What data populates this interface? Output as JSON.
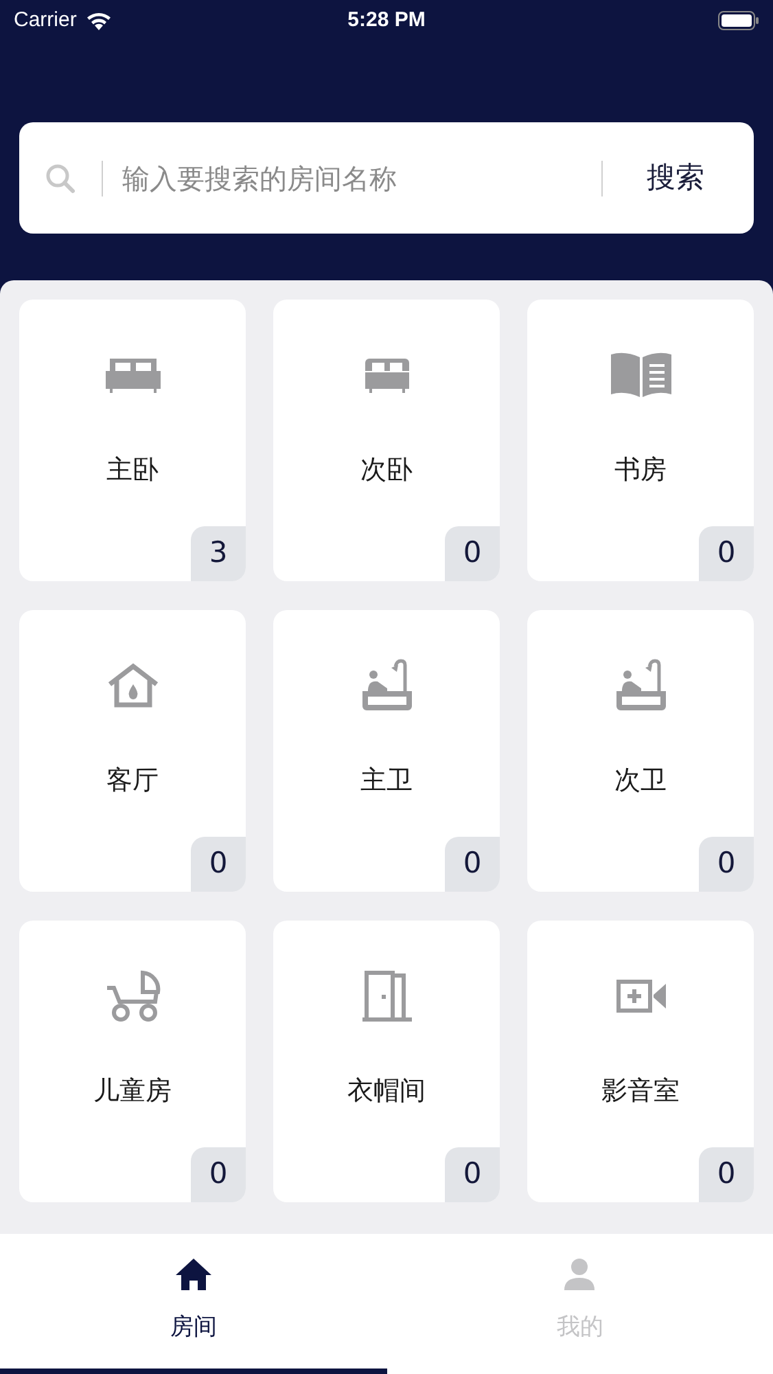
{
  "status_bar": {
    "carrier": "Carrier",
    "time": "5:28 PM"
  },
  "search": {
    "placeholder": "输入要搜索的房间名称",
    "button": "搜索"
  },
  "rooms": [
    {
      "name": "主卧",
      "count": "3",
      "kind": "double-bed"
    },
    {
      "name": "次卧",
      "count": "0",
      "kind": "single-bed"
    },
    {
      "name": "书房",
      "count": "0",
      "kind": "book"
    },
    {
      "name": "客厅",
      "count": "0",
      "kind": "house"
    },
    {
      "name": "主卫",
      "count": "0",
      "kind": "bathtub"
    },
    {
      "name": "次卫",
      "count": "0",
      "kind": "bathtub"
    },
    {
      "name": "儿童房",
      "count": "0",
      "kind": "stroller"
    },
    {
      "name": "衣帽间",
      "count": "0",
      "kind": "door"
    },
    {
      "name": "影音室",
      "count": "0",
      "kind": "video"
    }
  ],
  "tabs": [
    {
      "label": "房间",
      "selected": true,
      "kind": "home"
    },
    {
      "label": "我的",
      "selected": false,
      "kind": "person"
    }
  ]
}
